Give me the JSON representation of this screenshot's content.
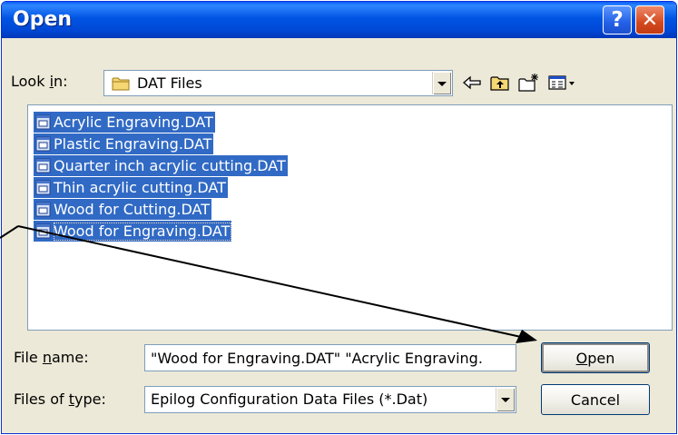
{
  "window": {
    "title": "Open",
    "help_glyph": "?",
    "close_glyph": "✕"
  },
  "lookin": {
    "label_before": "Look ",
    "label_accel": "i",
    "label_after": "n:",
    "value": "DAT Files"
  },
  "toolbar": {
    "icons": [
      "back-arrow-icon",
      "up-folder-icon",
      "new-folder-icon",
      "view-menu-icon"
    ]
  },
  "files": [
    {
      "name": "Acrylic Engraving.DAT"
    },
    {
      "name": "Plastic Engraving.DAT"
    },
    {
      "name": "Quarter inch acrylic cutting.DAT"
    },
    {
      "name": "Thin acrylic cutting.DAT"
    },
    {
      "name": "Wood for Cutting.DAT"
    },
    {
      "name": "Wood for Engraving.DAT"
    }
  ],
  "filename": {
    "label_before": "File ",
    "label_accel": "n",
    "label_after": "ame:",
    "value": "\"Wood for Engraving.DAT\" \"Acrylic Engraving."
  },
  "filetype": {
    "label_before": "Files of ",
    "label_accel": "t",
    "label_after": "ype:",
    "value": "Epilog Configuration Data Files (*.Dat)"
  },
  "buttons": {
    "open_accel": "O",
    "open_rest": "pen",
    "cancel": "Cancel"
  },
  "colors": {
    "selection": "#316ac5",
    "titlebar": "#0054e3",
    "dialog_bg": "#ece9d8"
  }
}
